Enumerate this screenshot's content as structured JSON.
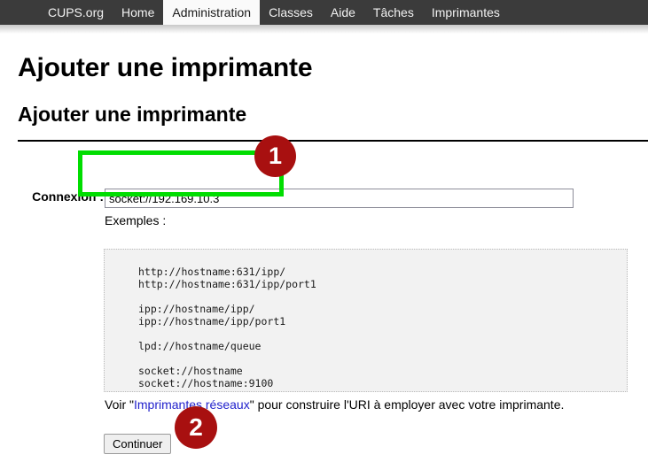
{
  "navbar": {
    "items": [
      {
        "label": "CUPS.org",
        "active": false
      },
      {
        "label": "Home",
        "active": false
      },
      {
        "label": "Administration",
        "active": true
      },
      {
        "label": "Classes",
        "active": false
      },
      {
        "label": "Aide",
        "active": false
      },
      {
        "label": "Tâches",
        "active": false
      },
      {
        "label": "Imprimantes",
        "active": false
      }
    ],
    "background_color": "#3b3b3b",
    "active_background_color": "#fafafa"
  },
  "page": {
    "title": "Ajouter une imprimante",
    "section_title": "Ajouter une imprimante"
  },
  "form": {
    "connection_label": "Connexion :",
    "connection_value": "socket://192.169.10.3",
    "connection_placeholder": "",
    "examples_label": "Exemples :",
    "examples_code": "http://hostname:631/ipp/\nhttp://hostname:631/ipp/port1\n\nipp://hostname/ipp/\nipp://hostname/ipp/port1\n\nlpd://hostname/queue\n\nsocket://hostname\nsocket://hostname:9100",
    "see_prefix": "Voir \"",
    "see_link": "Imprimantes réseaux",
    "see_suffix": "\" pour construire l'URI à employer avec votre imprimante.",
    "link_color": "#2222cc",
    "continue_label": "Continuer"
  },
  "annotations": {
    "badge_color": "#a81010",
    "box_color": "#00dd00",
    "badges": [
      {
        "number": "1"
      },
      {
        "number": "2"
      }
    ]
  }
}
